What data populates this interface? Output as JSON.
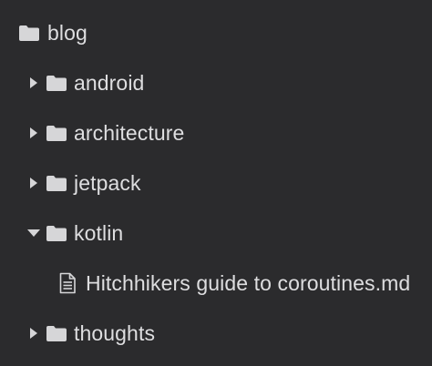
{
  "tree": {
    "root": {
      "label": "blog",
      "icon": "folder-icon"
    },
    "children": [
      {
        "label": "android",
        "icon": "folder-icon",
        "state": "collapsed"
      },
      {
        "label": "architecture",
        "icon": "folder-icon",
        "state": "collapsed"
      },
      {
        "label": "jetpack",
        "icon": "folder-icon",
        "state": "collapsed"
      },
      {
        "label": "kotlin",
        "icon": "folder-icon",
        "state": "expanded",
        "children": [
          {
            "label": "Hitchhikers guide to coroutines.md",
            "icon": "file-text-icon"
          }
        ]
      },
      {
        "label": "thoughts",
        "icon": "folder-icon",
        "state": "collapsed"
      }
    ]
  },
  "colors": {
    "background": "#2b2b2d",
    "text": "#dedee0",
    "icon": "#d6d6d8"
  }
}
